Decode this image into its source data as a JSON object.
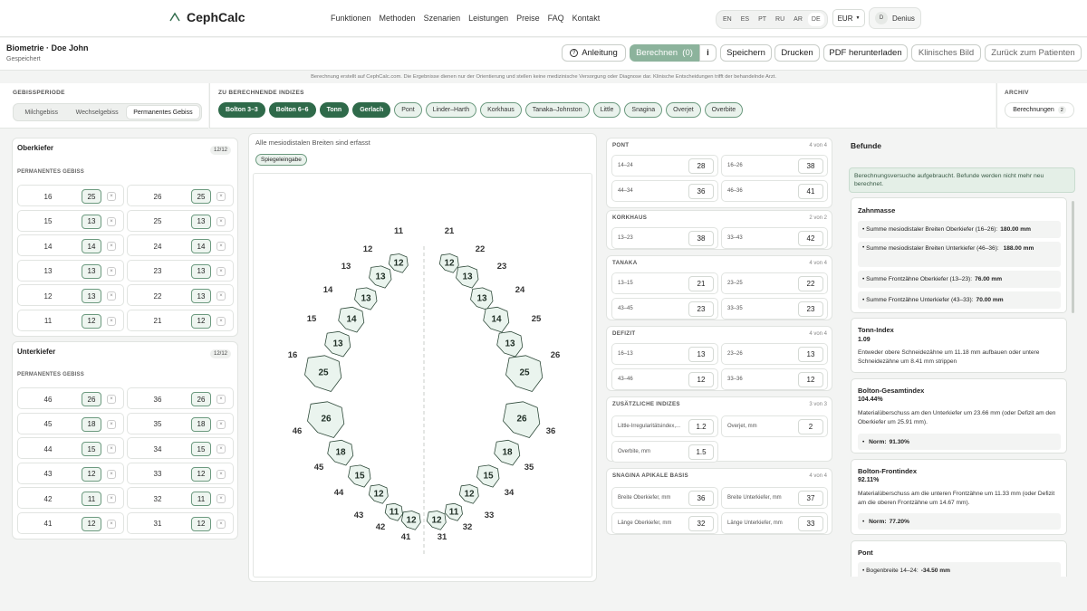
{
  "app": {
    "name": "CephCalc"
  },
  "nav": {
    "links": [
      "Funktionen",
      "Methoden",
      "Szenarien",
      "Leistungen",
      "Preise",
      "FAQ",
      "Kontakt"
    ],
    "languages": [
      "EN",
      "ES",
      "PT",
      "RU",
      "AR",
      "DE"
    ],
    "currency": "EUR",
    "user_initial": "D",
    "user_name": "Denius"
  },
  "header": {
    "title": "Biometrie · Doe John",
    "status": "Gespeichert",
    "buttons": {
      "guide": "Anleitung",
      "calculate": "Berechnen  (0)",
      "info": "i",
      "save": "Speichern",
      "print": "Drucken",
      "pdf": "PDF herunterladen",
      "clinical": "Klinisches Bild",
      "back": "Zurück zum Patienten"
    }
  },
  "disclaimer": "Berechnung erstellt auf CephCalc.com. Die Ergebnisse dienen nur der Orientierung und stellen keine medizinische Versorgung oder Diagnose dar. Klinische Entscheidungen trifft der behandelnde Arzt.",
  "period": {
    "label": "GEBISSPERIODE",
    "options": [
      "Milchgebiss",
      "Wechselgebiss",
      "Permanentes Gebiss"
    ],
    "selected": "Permanentes Gebiss"
  },
  "indices": {
    "label": "ZU BERECHNENDE INDIZES",
    "chips": [
      {
        "name": "Bolton 3–3",
        "on": true
      },
      {
        "name": "Bolton 6–6",
        "on": true
      },
      {
        "name": "Tonn",
        "on": true
      },
      {
        "name": "Gerlach",
        "on": true
      },
      {
        "name": "Pont",
        "on": false
      },
      {
        "name": "Linder–Harth",
        "on": false
      },
      {
        "name": "Korkhaus",
        "on": false
      },
      {
        "name": "Tanaka–Johnston",
        "on": false
      },
      {
        "name": "Little",
        "on": false
      },
      {
        "name": "Snagina",
        "on": false
      },
      {
        "name": "Overjet",
        "on": false
      },
      {
        "name": "Overbite",
        "on": false
      }
    ]
  },
  "archive": {
    "label": "ARCHIV",
    "button": "Berechnungen",
    "count": "2"
  },
  "upper": {
    "title": "Oberkiefer",
    "count": "12/12",
    "subtitle": "PERMANENTES GEBISS",
    "rows": [
      [
        "16",
        "25",
        "26",
        "25"
      ],
      [
        "15",
        "13",
        "25",
        "13"
      ],
      [
        "14",
        "14",
        "24",
        "14"
      ],
      [
        "13",
        "13",
        "23",
        "13"
      ],
      [
        "12",
        "13",
        "22",
        "13"
      ],
      [
        "11",
        "12",
        "21",
        "12"
      ]
    ]
  },
  "lower": {
    "title": "Unterkiefer",
    "count": "12/12",
    "subtitle": "PERMANENTES GEBISS",
    "rows": [
      [
        "46",
        "26",
        "36",
        "26"
      ],
      [
        "45",
        "18",
        "35",
        "18"
      ],
      [
        "44",
        "15",
        "34",
        "15"
      ],
      [
        "43",
        "12",
        "33",
        "12"
      ],
      [
        "42",
        "11",
        "32",
        "11"
      ],
      [
        "41",
        "12",
        "31",
        "12"
      ]
    ]
  },
  "center": {
    "status": "Alle mesiodistalen Breiten sind erfasst",
    "mirror": "Spiegeleingabe"
  },
  "diagram": {
    "upper_right": [
      [
        "11",
        "12"
      ],
      [
        "12",
        "13"
      ],
      [
        "13",
        "13"
      ],
      [
        "14",
        "14"
      ],
      [
        "15",
        "13"
      ],
      [
        "16",
        "25"
      ]
    ],
    "upper_left": [
      [
        "21",
        "12"
      ],
      [
        "22",
        "13"
      ],
      [
        "23",
        "13"
      ],
      [
        "24",
        "14"
      ],
      [
        "25",
        "13"
      ],
      [
        "26",
        "25"
      ]
    ],
    "lower_right": [
      [
        "46",
        "26"
      ],
      [
        "45",
        "18"
      ],
      [
        "44",
        "15"
      ],
      [
        "43",
        "12"
      ],
      [
        "42",
        "11"
      ],
      [
        "41",
        "12"
      ]
    ],
    "lower_left": [
      [
        "36",
        "26"
      ],
      [
        "35",
        "18"
      ],
      [
        "34",
        "15"
      ],
      [
        "33",
        "12"
      ],
      [
        "32",
        "11"
      ],
      [
        "31",
        "12"
      ]
    ]
  },
  "idx": {
    "pont": {
      "title": "PONT",
      "count": "4 von 4",
      "cells": [
        [
          "14–24",
          "28"
        ],
        [
          "16–26",
          "38"
        ],
        [
          "44–34",
          "36"
        ],
        [
          "46–36",
          "41"
        ]
      ]
    },
    "korkhaus": {
      "title": "KORKHAUS",
      "count": "2 von 2",
      "cells": [
        [
          "13–23",
          "38"
        ],
        [
          "33–43",
          "42"
        ]
      ]
    },
    "tanaka": {
      "title": "TANAKA",
      "count": "4 von 4",
      "cells": [
        [
          "13–15",
          "21"
        ],
        [
          "23–25",
          "22"
        ],
        [
          "43–45",
          "23"
        ],
        [
          "33–35",
          "23"
        ]
      ]
    },
    "defizit": {
      "title": "DEFIZIT",
      "count": "4 von 4",
      "cells": [
        [
          "16–13",
          "13"
        ],
        [
          "23–26",
          "13"
        ],
        [
          "43–46",
          "12"
        ],
        [
          "33–36",
          "12"
        ]
      ]
    },
    "extra": {
      "title": "ZUSÄTZLICHE INDIZES",
      "count": "3 von 3",
      "cells": [
        [
          "Little-Irregularitätsindex,...",
          "1.2"
        ],
        [
          "Overjet, mm",
          "2"
        ],
        [
          "Overbite, mm",
          "1.5"
        ]
      ]
    },
    "snagina": {
      "title": "SNAGINA APIKALE BASIS",
      "count": "4 von 4",
      "cells": [
        [
          "Breite Oberkiefer, mm",
          "36"
        ],
        [
          "Breite Unterkiefer, mm",
          "37"
        ],
        [
          "Länge Oberkiefer, mm",
          "32"
        ],
        [
          "Länge Unterkiefer, mm",
          "33"
        ]
      ]
    }
  },
  "findings": {
    "title": "Befunde",
    "alert": "Berechnungsversuche aufgebraucht. Befunde werden nicht mehr neu berechnet.",
    "zahnmasse": {
      "title": "Zahnmasse",
      "items": [
        [
          "Summe mesiodistaler Breiten Oberkiefer (16–26):",
          "180.00 mm"
        ],
        [
          "Summe mesiodistaler Breiten Unterkiefer (46–36):",
          "188.00 mm"
        ],
        [
          "Summe Frontzähne Oberkiefer (13–23):",
          "76.00 mm"
        ],
        [
          "Summe Frontzähne Unterkiefer (43–33):",
          "70.00 mm"
        ]
      ]
    },
    "tonn": {
      "title": "Tonn-Index",
      "value": "1.09",
      "text": "Entweder obere Schneidezähne um 11.18 mm aufbauen oder untere Schneidezähne um 8.41 mm strippen"
    },
    "bolton_total": {
      "title": "Bolton-Gesamtindex",
      "value": "104.44%",
      "text": "Materialüberschuss am den Unterkiefer um 23.66 mm (oder Defizit am den Oberkiefer um 25.91 mm).",
      "norm_label": "Norm:",
      "norm": "91.30%"
    },
    "bolton_front": {
      "title": "Bolton-Frontindex",
      "value": "92.11%",
      "text": "Materialüberschuss am die unteren Frontzähne um 11.33 mm (oder Defizit am die oberen Frontzähne um 14.67 mm).",
      "norm_label": "Norm:",
      "norm": "77.20%"
    },
    "pont": {
      "title": "Pont",
      "item_label": "Bogenbreite 14–24:",
      "item_value": "-34.50 mm"
    }
  }
}
